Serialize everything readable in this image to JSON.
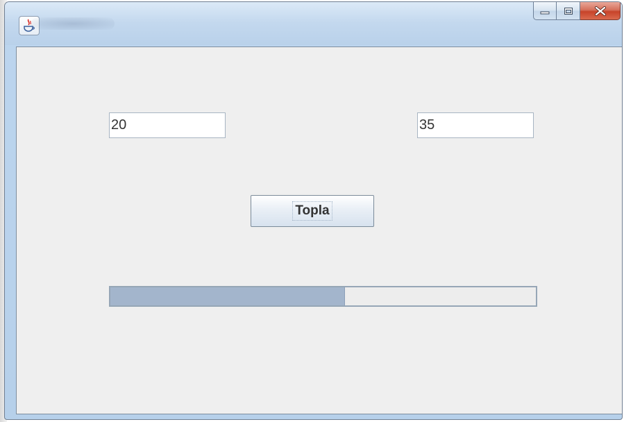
{
  "window": {
    "title": ""
  },
  "icons": {
    "app": "java-coffee-icon",
    "minimize": "minimize-icon",
    "maximize": "maximize-icon",
    "close": "close-icon"
  },
  "form": {
    "first_value": "20",
    "second_value": "35",
    "add_button_label": "Topla"
  },
  "progress": {
    "value_percent": 55
  },
  "colors": {
    "close_button": "#c7432a",
    "progress_fill": "#a3b5cc",
    "panel_background": "#efefef"
  }
}
